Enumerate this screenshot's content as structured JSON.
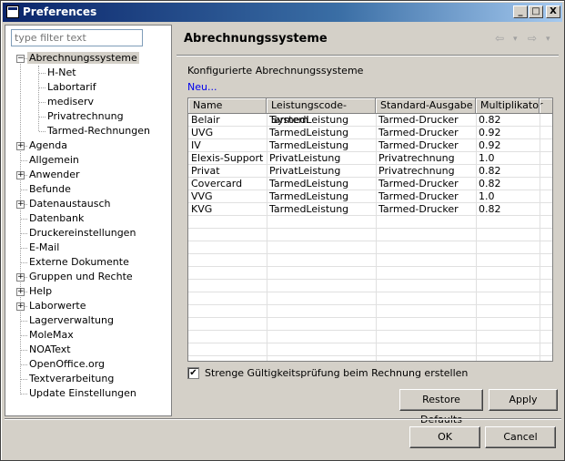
{
  "window": {
    "title": "Preferences"
  },
  "titlebar_buttons": {
    "minimize": "_",
    "maximize": "□",
    "close": "X"
  },
  "filter": {
    "placeholder": "type filter text"
  },
  "tree": {
    "items": [
      {
        "label": "Abrechnungssysteme",
        "level": 0,
        "expander": "−",
        "selected": true
      },
      {
        "label": "H-Net",
        "level": 1
      },
      {
        "label": "Labortarif",
        "level": 1
      },
      {
        "label": "mediserv",
        "level": 1
      },
      {
        "label": "Privatrechnung",
        "level": 1
      },
      {
        "label": "Tarmed-Rechnungen",
        "level": 1
      },
      {
        "label": "Agenda",
        "level": 0,
        "expander": "+"
      },
      {
        "label": "Allgemein",
        "level": 0
      },
      {
        "label": "Anwender",
        "level": 0,
        "expander": "+"
      },
      {
        "label": "Befunde",
        "level": 0
      },
      {
        "label": "Datenaustausch",
        "level": 0,
        "expander": "+"
      },
      {
        "label": "Datenbank",
        "level": 0
      },
      {
        "label": "Druckereinstellungen",
        "level": 0
      },
      {
        "label": "E-Mail",
        "level": 0
      },
      {
        "label": "Externe Dokumente",
        "level": 0
      },
      {
        "label": "Gruppen und Rechte",
        "level": 0,
        "expander": "+"
      },
      {
        "label": "Help",
        "level": 0,
        "expander": "+"
      },
      {
        "label": "Laborwerte",
        "level": 0,
        "expander": "+"
      },
      {
        "label": "Lagerverwaltung",
        "level": 0
      },
      {
        "label": "MoleMax",
        "level": 0
      },
      {
        "label": "NOAText",
        "level": 0
      },
      {
        "label": "OpenOffice.org",
        "level": 0
      },
      {
        "label": "Textverarbeitung",
        "level": 0
      },
      {
        "label": "Update Einstellungen",
        "level": 0
      }
    ]
  },
  "page": {
    "title": "Abrechnungssysteme",
    "nav_back": "⇦",
    "nav_forward": "⇨",
    "nav_dropdown": "▾",
    "section_label": "Konfigurierte Abrechnungssysteme",
    "new_link": "Neu...",
    "columns": [
      "Name",
      "Leistungscode-System",
      "Standard-Ausgabe",
      "Multiplikator"
    ],
    "rows": [
      [
        "Belair",
        "TarmedLeistung",
        "Tarmed-Drucker",
        "0.82"
      ],
      [
        "UVG",
        "TarmedLeistung",
        "Tarmed-Drucker",
        "0.92"
      ],
      [
        "IV",
        "TarmedLeistung",
        "Tarmed-Drucker",
        "0.92"
      ],
      [
        "Elexis-Support",
        "PrivatLeistung",
        "Privatrechnung",
        "1.0"
      ],
      [
        "Privat",
        "PrivatLeistung",
        "Privatrechnung",
        "0.82"
      ],
      [
        "Covercard",
        "TarmedLeistung",
        "Tarmed-Drucker",
        "0.82"
      ],
      [
        "VVG",
        "TarmedLeistung",
        "Tarmed-Drucker",
        "1.0"
      ],
      [
        "KVG",
        "TarmedLeistung",
        "Tarmed-Drucker",
        "0.82"
      ]
    ],
    "checkbox_label": "Strenge Gültigkeitsprüfung beim Rechnung erstellen",
    "checkbox_mark": "✔",
    "restore_label": "Restore Defaults",
    "apply_label": "Apply"
  },
  "footer": {
    "ok_label": "OK",
    "cancel_label": "Cancel"
  }
}
